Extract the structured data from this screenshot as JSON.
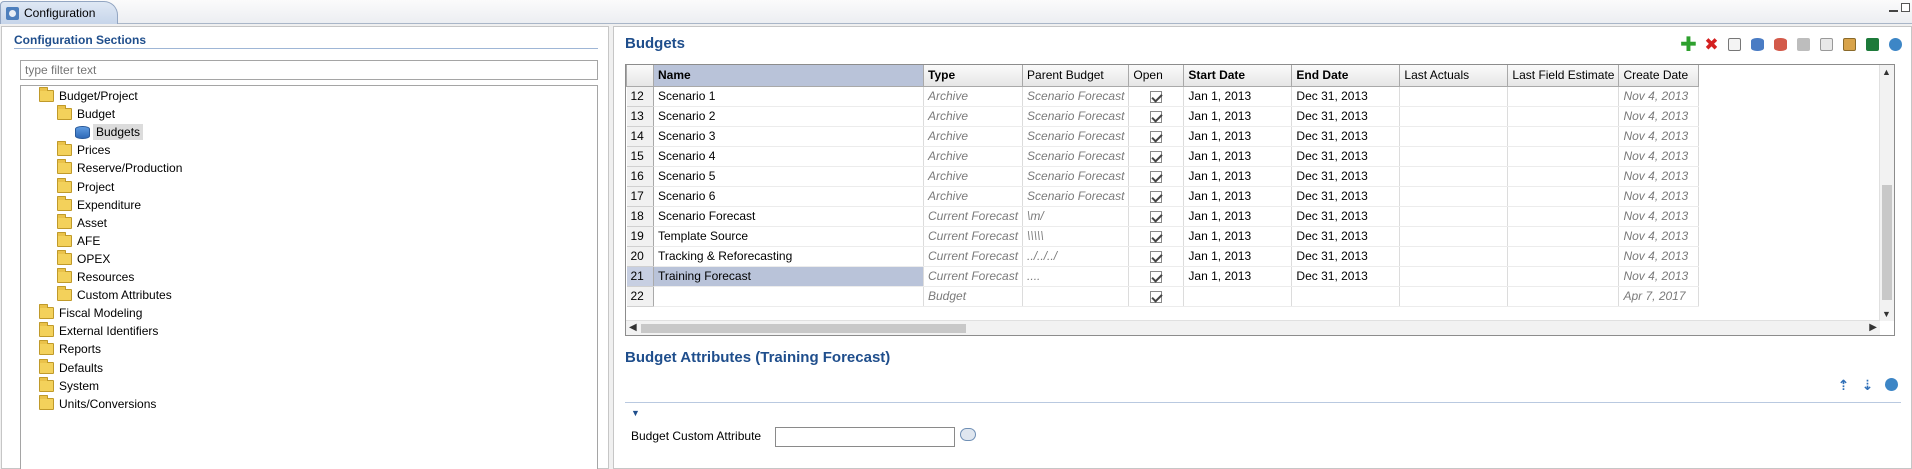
{
  "tab": {
    "title": "Configuration"
  },
  "left": {
    "title": "Configuration Sections",
    "filter_placeholder": "type filter text",
    "tree": [
      {
        "label": "Budget/Project",
        "icon": "folder-icon",
        "level": 0
      },
      {
        "label": "Budget",
        "icon": "folder-icon",
        "level": 1
      },
      {
        "label": "Budgets",
        "icon": "database-icon",
        "level": 2,
        "selected": true
      },
      {
        "label": "Prices",
        "icon": "folder-icon",
        "level": 1
      },
      {
        "label": "Reserve/Production",
        "icon": "folder-icon",
        "level": 1
      },
      {
        "label": "Project",
        "icon": "folder-icon",
        "level": 1
      },
      {
        "label": "Expenditure",
        "icon": "folder-icon",
        "level": 1
      },
      {
        "label": "Asset",
        "icon": "folder-icon",
        "level": 1
      },
      {
        "label": "AFE",
        "icon": "folder-icon",
        "level": 1
      },
      {
        "label": "OPEX",
        "icon": "folder-icon",
        "level": 1
      },
      {
        "label": "Resources",
        "icon": "folder-icon",
        "level": 1
      },
      {
        "label": "Custom Attributes",
        "icon": "folder-icon",
        "level": 1
      },
      {
        "label": "Fiscal Modeling",
        "icon": "folder-icon",
        "level": 0
      },
      {
        "label": "External Identifiers",
        "icon": "folder-icon",
        "level": 0
      },
      {
        "label": "Reports",
        "icon": "folder-icon",
        "level": 0
      },
      {
        "label": "Defaults",
        "icon": "folder-icon",
        "level": 0
      },
      {
        "label": "System",
        "icon": "folder-icon",
        "level": 0
      },
      {
        "label": "Units/Conversions",
        "icon": "folder-icon",
        "level": 0
      }
    ]
  },
  "budgets": {
    "title": "Budgets",
    "toolbar": [
      "add-icon",
      "delete-icon",
      "edit-icon",
      "db-export-icon",
      "db-import-icon",
      "print-icon",
      "copy-icon",
      "grid-settings-icon",
      "excel-icon",
      "refresh-icon"
    ],
    "columns": [
      {
        "label": "",
        "width": 27
      },
      {
        "label": "Name",
        "bold": true,
        "width": 270
      },
      {
        "label": "Type",
        "bold": true,
        "width": 90
      },
      {
        "label": "Parent Budget",
        "width": 90
      },
      {
        "label": "Open",
        "width": 55
      },
      {
        "label": "Start Date",
        "bold": true,
        "width": 108
      },
      {
        "label": "End Date",
        "bold": true,
        "width": 108
      },
      {
        "label": "Last Actuals",
        "width": 108
      },
      {
        "label": "Last Field Estimate",
        "width": 108
      },
      {
        "label": "Create Date",
        "width": 80
      }
    ],
    "rows": [
      {
        "num": "12",
        "name": "Scenario 1",
        "type": "Archive",
        "parent": "Scenario Forecast",
        "open": true,
        "start": "Jan 1, 2013",
        "end": "Dec 31, 2013",
        "last_actuals": "",
        "last_field": "",
        "create": "Nov 4, 2013"
      },
      {
        "num": "13",
        "name": "Scenario 2",
        "type": "Archive",
        "parent": "Scenario Forecast",
        "open": true,
        "start": "Jan 1, 2013",
        "end": "Dec 31, 2013",
        "last_actuals": "",
        "last_field": "",
        "create": "Nov 4, 2013"
      },
      {
        "num": "14",
        "name": "Scenario 3",
        "type": "Archive",
        "parent": "Scenario Forecast",
        "open": true,
        "start": "Jan 1, 2013",
        "end": "Dec 31, 2013",
        "last_actuals": "",
        "last_field": "",
        "create": "Nov 4, 2013"
      },
      {
        "num": "15",
        "name": "Scenario 4",
        "type": "Archive",
        "parent": "Scenario Forecast",
        "open": true,
        "start": "Jan 1, 2013",
        "end": "Dec 31, 2013",
        "last_actuals": "",
        "last_field": "",
        "create": "Nov 4, 2013"
      },
      {
        "num": "16",
        "name": "Scenario 5",
        "type": "Archive",
        "parent": "Scenario Forecast",
        "open": true,
        "start": "Jan 1, 2013",
        "end": "Dec 31, 2013",
        "last_actuals": "",
        "last_field": "",
        "create": "Nov 4, 2013"
      },
      {
        "num": "17",
        "name": "Scenario 6",
        "type": "Archive",
        "parent": "Scenario Forecast",
        "open": true,
        "start": "Jan 1, 2013",
        "end": "Dec 31, 2013",
        "last_actuals": "",
        "last_field": "",
        "create": "Nov 4, 2013"
      },
      {
        "num": "18",
        "name": "Scenario Forecast",
        "type": "Current Forecast",
        "parent": "\\m/",
        "open": true,
        "start": "Jan 1, 2013",
        "end": "Dec 31, 2013",
        "last_actuals": "",
        "last_field": "",
        "create": "Nov 4, 2013"
      },
      {
        "num": "19",
        "name": "Template Source",
        "type": "Current Forecast",
        "parent": "\\\\\\\\\\",
        "open": true,
        "start": "Jan 1, 2013",
        "end": "Dec 31, 2013",
        "last_actuals": "",
        "last_field": "",
        "create": "Nov 4, 2013"
      },
      {
        "num": "20",
        "name": "Tracking & Reforecasting",
        "type": "Current Forecast",
        "parent": "../../../",
        "open": true,
        "start": "Jan 1, 2013",
        "end": "Dec 31, 2013",
        "last_actuals": "",
        "last_field": "",
        "create": "Nov 4, 2013"
      },
      {
        "num": "21",
        "name": "Training Forecast",
        "type": "Current Forecast",
        "parent": "....",
        "open": true,
        "start": "Jan 1, 2013",
        "end": "Dec 31, 2013",
        "last_actuals": "",
        "last_field": "",
        "create": "Nov 4, 2013",
        "selected": true
      },
      {
        "num": "22",
        "name": "",
        "type": "Budget",
        "parent": "",
        "open": true,
        "start": "",
        "end": "",
        "last_actuals": "",
        "last_field": "",
        "create": "Apr 7, 2017"
      }
    ]
  },
  "attributes": {
    "title": "Budget Attributes (Training Forecast)",
    "field_label": "Budget Custom Attribute",
    "field_value": "",
    "tools": [
      "move-up-icon",
      "move-down-icon",
      "refresh-icon"
    ]
  },
  "colors": {
    "accent": "#1f4e8c",
    "selection": "#b9c3d9"
  }
}
